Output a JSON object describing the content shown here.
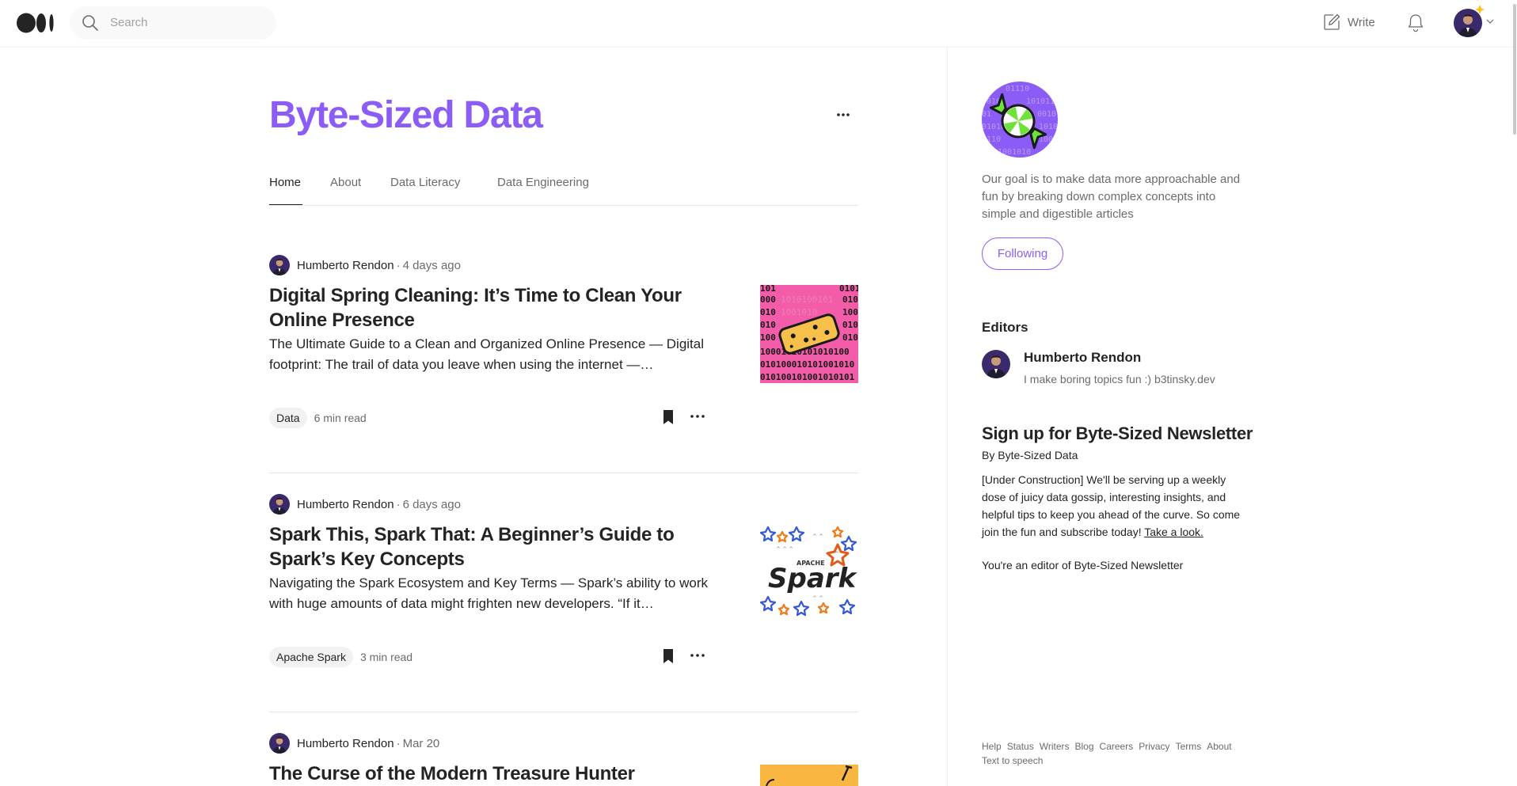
{
  "topbar": {
    "search_placeholder": "Search",
    "write_label": "Write"
  },
  "publication": {
    "title": "Byte-Sized Data",
    "accent_color": "#8b5cf6",
    "tabs": [
      {
        "label": "Home",
        "active": true
      },
      {
        "label": "About",
        "active": false
      },
      {
        "label": "Data Literacy",
        "active": false
      },
      {
        "label": "Data Engineering",
        "active": false
      }
    ]
  },
  "articles": [
    {
      "author": "Humberto Rendon",
      "date": "4 days ago",
      "title": "Digital Spring Cleaning: It’s Time to Clean Your Online Presence",
      "subtitle": "The Ultimate Guide to a Clean and Organized Online Presence — Digital footprint: The trail of data you leave when using the internet —…",
      "tag": "Data",
      "read_time": "6 min read",
      "thumb": "binary-sponge"
    },
    {
      "author": "Humberto Rendon",
      "date": "6 days ago",
      "title": "Spark This, Spark That: A Beginner’s Guide to Spark’s Key Concepts",
      "subtitle": "Navigating the Spark Ecosystem and Key Terms — Spark’s ability to work with huge amounts of data might frighten new developers. “If it…",
      "tag": "Apache Spark",
      "read_time": "3 min read",
      "thumb": "apache-spark-logo"
    },
    {
      "author": "Humberto Rendon",
      "date": "Mar 20",
      "title": "The Curse of the Modern Treasure Hunter",
      "thumb": "treasure-shovel"
    }
  ],
  "sidebar": {
    "description": "Our goal is to make data more approachable and fun by breaking down complex concepts into simple and digestible articles",
    "follow_label": "Following",
    "editors_heading": "Editors",
    "editor": {
      "name": "Humberto Rendon",
      "bio": "I make boring topics fun :) b3tinsky.dev"
    },
    "newsletter": {
      "title": "Sign up for Byte-Sized Newsletter",
      "by": "By Byte-Sized Data",
      "body": "[Under Construction] We'll be serving up a weekly dose of juicy data gossip, interesting insights, and helpful tips to keep you ahead of the curve. So come join the fun and subscribe today!",
      "link": "Take a look.",
      "editor_note": "You're an editor of Byte-Sized Newsletter"
    },
    "footer_links": [
      "Help",
      "Status",
      "Writers",
      "Blog",
      "Careers",
      "Privacy",
      "Terms",
      "About",
      "Text to speech"
    ]
  }
}
